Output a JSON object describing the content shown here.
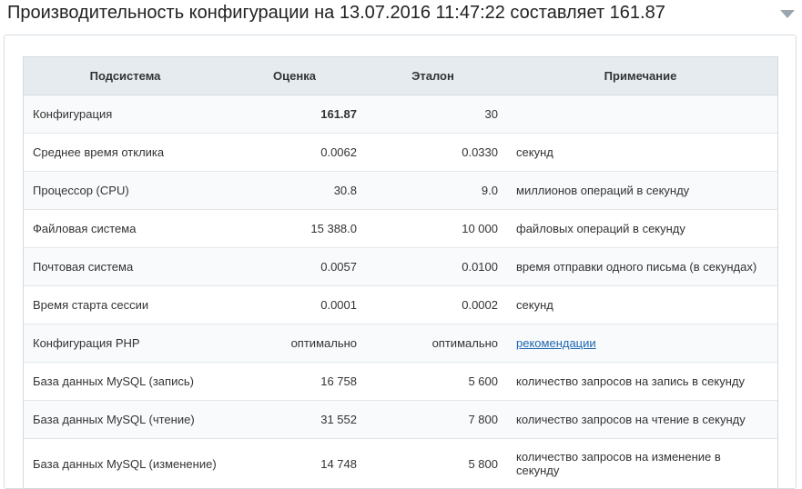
{
  "header": {
    "title": "Производительность конфигурации на 13.07.2016 11:47:22 составляет 161.87",
    "toggle_icon": "chevron-down-icon"
  },
  "table": {
    "columns": [
      "Подсистема",
      "Оценка",
      "Эталон",
      "Примечание"
    ],
    "rows": [
      {
        "subsystem": "Конфигурация",
        "score": "161.87",
        "reference": "30",
        "note": ""
      },
      {
        "subsystem": "Среднее время отклика",
        "score": "0.0062",
        "reference": "0.0330",
        "note": "секунд"
      },
      {
        "subsystem": "Процессор (CPU)",
        "score": "30.8",
        "reference": "9.0",
        "note": "миллионов операций в секунду"
      },
      {
        "subsystem": "Файловая система",
        "score": "15 388.0",
        "reference": "10 000",
        "note": "файловых операций в секунду"
      },
      {
        "subsystem": "Почтовая система",
        "score": "0.0057",
        "reference": "0.0100",
        "note": "время отправки одного письма (в секундах)"
      },
      {
        "subsystem": "Время старта сессии",
        "score": "0.0001",
        "reference": "0.0002",
        "note": "секунд"
      },
      {
        "subsystem": "Конфигурация PHP",
        "score": "оптимально",
        "reference": "оптимально",
        "note": "рекомендации"
      },
      {
        "subsystem": "База данных MySQL (запись)",
        "score": "16 758",
        "reference": "5 600",
        "note": "количество запросов на запись в секунду"
      },
      {
        "subsystem": "База данных MySQL (чтение)",
        "score": "31 552",
        "reference": "7 800",
        "note": "количество запросов на чтение в секунду"
      },
      {
        "subsystem": "База данных MySQL (изменение)",
        "score": "14 748",
        "reference": "5 800",
        "note": "количество запросов на изменение в секунду"
      }
    ]
  },
  "colors": {
    "header_bg": "#e5ebef",
    "link": "#2067b0",
    "border": "#d3dadf"
  }
}
